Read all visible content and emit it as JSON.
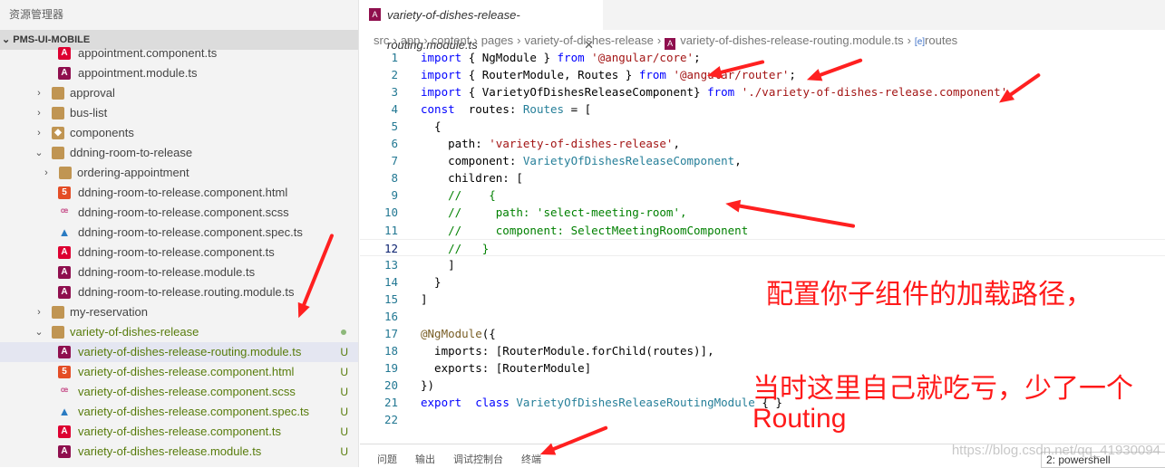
{
  "sidebar": {
    "title": "资源管理器",
    "root": "PMS-UI-MOBILE",
    "items": [
      {
        "label": "appointment.component.ts",
        "icon": "angular-component-icon",
        "depth": 2
      },
      {
        "label": "appointment.module.ts",
        "icon": "angular-module-icon",
        "depth": 2
      },
      {
        "label": "approval",
        "icon": "folder-icon",
        "depth": 1,
        "chevron": "›"
      },
      {
        "label": "bus-list",
        "icon": "folder-icon",
        "depth": 1,
        "chevron": "›"
      },
      {
        "label": "components",
        "icon": "components-folder-icon",
        "depth": 1,
        "chevron": "›"
      },
      {
        "label": "ddning-room-to-release",
        "icon": "folder-open-icon",
        "depth": 1,
        "chevron": "⌄"
      },
      {
        "label": "ordering-appointment",
        "icon": "folder-icon",
        "depth": 2,
        "chevron": "›"
      },
      {
        "label": "ddning-room-to-release.component.html",
        "icon": "html-icon",
        "depth": 2
      },
      {
        "label": "ddning-room-to-release.component.scss",
        "icon": "scss-icon",
        "depth": 2
      },
      {
        "label": "ddning-room-to-release.component.spec.ts",
        "icon": "spec-icon",
        "depth": 2
      },
      {
        "label": "ddning-room-to-release.component.ts",
        "icon": "angular-component-icon",
        "depth": 2
      },
      {
        "label": "ddning-room-to-release.module.ts",
        "icon": "angular-module-icon",
        "depth": 2
      },
      {
        "label": "ddning-room-to-release.routing.module.ts",
        "icon": "angular-module-icon",
        "depth": 2
      },
      {
        "label": "my-reservation",
        "icon": "folder-icon",
        "depth": 1,
        "chevron": "›"
      },
      {
        "label": "variety-of-dishes-release",
        "icon": "folder-open-icon",
        "depth": 1,
        "chevron": "⌄",
        "green": true,
        "dot": true
      },
      {
        "label": "variety-of-dishes-release-routing.module.ts",
        "icon": "angular-module-icon",
        "depth": 2,
        "green": true,
        "badge": "U",
        "selected": true
      },
      {
        "label": "variety-of-dishes-release.component.html",
        "icon": "html-icon",
        "depth": 2,
        "green": true,
        "badge": "U"
      },
      {
        "label": "variety-of-dishes-release.component.scss",
        "icon": "scss-icon",
        "depth": 2,
        "green": true,
        "badge": "U"
      },
      {
        "label": "variety-of-dishes-release.component.spec.ts",
        "icon": "spec-icon",
        "depth": 2,
        "green": true,
        "badge": "U"
      },
      {
        "label": "variety-of-dishes-release.component.ts",
        "icon": "angular-component-icon",
        "depth": 2,
        "green": true,
        "badge": "U"
      },
      {
        "label": "variety-of-dishes-release.module.ts",
        "icon": "angular-module-icon",
        "depth": 2,
        "green": true,
        "badge": "U"
      }
    ]
  },
  "editor": {
    "tab": "variety-of-dishes-release-routing.module.ts",
    "breadcrumbs": [
      "src",
      "app",
      "content",
      "pages",
      "variety-of-dishes-release",
      "variety-of-dishes-release-routing.module.ts",
      "routes"
    ],
    "current_line": 12,
    "lines": [
      [
        [
          "kw",
          "import"
        ],
        [
          "",
          "{ NgModule } "
        ],
        [
          "kw",
          "from"
        ],
        [
          "",
          ""
        ],
        [
          "str",
          " '@angular/core'"
        ],
        [
          "",
          ";"
        ]
      ],
      [
        [
          "kw",
          "import"
        ],
        [
          "",
          "{ RouterModule, Routes } "
        ],
        [
          "kw",
          "from"
        ],
        [
          "str",
          " '@angular/router'"
        ],
        [
          "",
          ";"
        ]
      ],
      [
        [
          "kw",
          "import"
        ],
        [
          "",
          "{ VarietyOfDishesReleaseComponent} "
        ],
        [
          "kw",
          "from"
        ],
        [
          "str",
          " './variety-of-dishes-release.component'"
        ]
      ],
      [
        [
          "kw",
          "const"
        ],
        [
          "",
          " routes: "
        ],
        [
          "ty",
          "Routes"
        ],
        [
          "",
          " = ["
        ]
      ],
      [
        [
          "",
          "  {"
        ]
      ],
      [
        [
          "",
          "    path: "
        ],
        [
          "str",
          "'variety-of-dishes-release'"
        ],
        [
          "",
          ","
        ]
      ],
      [
        [
          "",
          "    component: "
        ],
        [
          "ty",
          "VarietyOfDishesReleaseComponent"
        ],
        [
          "",
          ","
        ]
      ],
      [
        [
          "",
          "    children: ["
        ]
      ],
      [
        [
          "cm",
          "    //    {"
        ]
      ],
      [
        [
          "cm",
          "    //     path: 'select-meeting-room',"
        ]
      ],
      [
        [
          "cm",
          "    //     component: SelectMeetingRoomComponent"
        ]
      ],
      [
        [
          "cm",
          "    //   }"
        ]
      ],
      [
        [
          "",
          "    ]"
        ]
      ],
      [
        [
          "",
          "  }"
        ]
      ],
      [
        [
          "",
          "]"
        ]
      ],
      [
        [
          "",
          ""
        ]
      ],
      [
        [
          "dec",
          "@NgModule"
        ],
        [
          "",
          "({"
        ]
      ],
      [
        [
          "",
          "  imports: [RouterModule.forChild(routes)],"
        ]
      ],
      [
        [
          "",
          "  exports: [RouterModule]"
        ]
      ],
      [
        [
          "",
          "})"
        ]
      ],
      [
        [
          "kw",
          "export"
        ],
        [
          "",
          " "
        ],
        [
          "kw",
          "class"
        ],
        [
          "",
          " "
        ],
        [
          "ty",
          "VarietyOfDishesReleaseRoutingModule"
        ],
        [
          "",
          " { }"
        ]
      ],
      [
        [
          "",
          ""
        ]
      ]
    ]
  },
  "panel": {
    "tabs": [
      "问题",
      "输出",
      "调试控制台",
      "终端"
    ],
    "terminal": "2: powershell"
  },
  "annotations": {
    "note1": "配置你子组件的加载路径，",
    "note2_line1": "当时这里自己就吃亏，少了一个",
    "note2_line2": "Routing"
  },
  "watermark": "https://blog.csdn.net/qq_41930094",
  "colors": {
    "annotation": "#ff1a1a",
    "git_untracked": "#587c0c",
    "keyword": "#0000ff",
    "string": "#a31515",
    "comment": "#008000"
  }
}
